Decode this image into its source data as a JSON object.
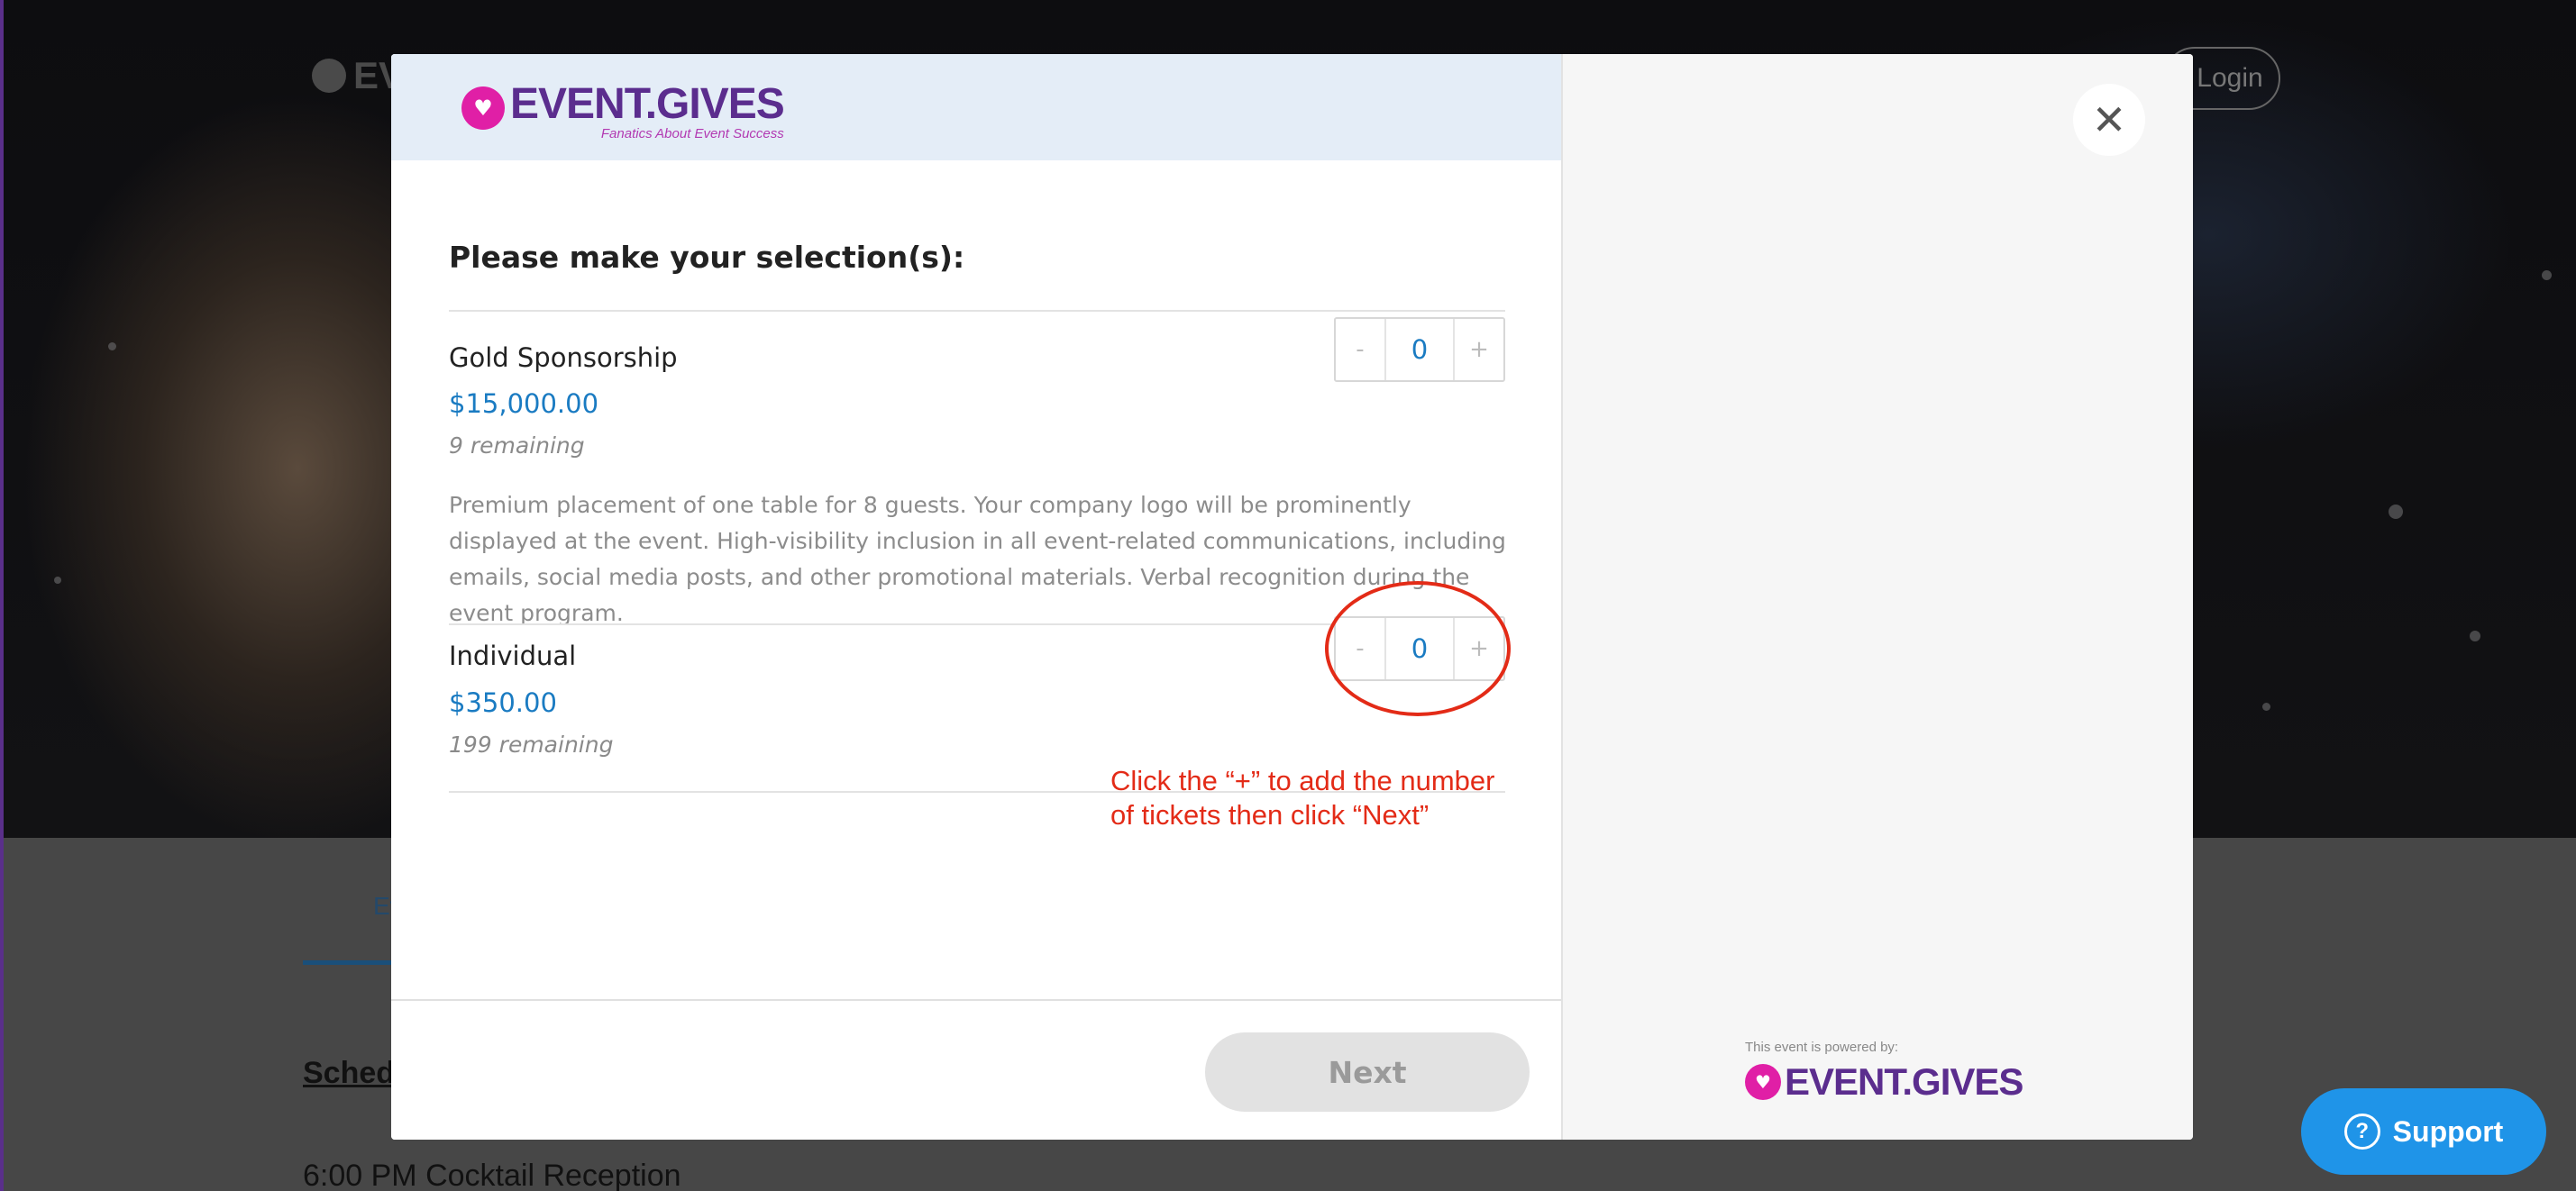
{
  "background": {
    "logo_text": "EV",
    "login_label": "Login",
    "tab_label": "Ev",
    "schedule_heading": "Schedule",
    "schedule_item": "6:00 PM Cocktail Reception"
  },
  "modal": {
    "brand": {
      "name": "EVENT.GIVES",
      "tagline": "Fanatics About Event Success"
    },
    "heading": "Please make your selection(s):",
    "items": [
      {
        "name": "Gold Sponsorship",
        "price": "$15,000.00",
        "remaining": "9 remaining",
        "description": "Premium placement of one table for 8 guests. Your company logo will be prominently displayed at the event. High-visibility inclusion in all event-related communications, including emails, social media posts, and other promotional materials. Verbal recognition during the event program.",
        "quantity": "0",
        "minus": "-",
        "plus": "+"
      },
      {
        "name": "Individual",
        "price": "$350.00",
        "remaining": "199 remaining",
        "quantity": "0",
        "minus": "-",
        "plus": "+"
      }
    ],
    "annotation": "Click the “+” to add the number of tickets then click “Next”",
    "next_label": "Next",
    "close_symbol": "✕",
    "powered_label": "This event is powered by:",
    "powered_brand": "EVENT.GIVES"
  },
  "support": {
    "label": "Support",
    "icon": "?"
  },
  "colors": {
    "brand_purple": "#5b2d8e",
    "brand_pink": "#e01fa6",
    "price_blue": "#1a7bc2",
    "annotation_red": "#e32b17",
    "support_blue": "#1f94e8"
  }
}
